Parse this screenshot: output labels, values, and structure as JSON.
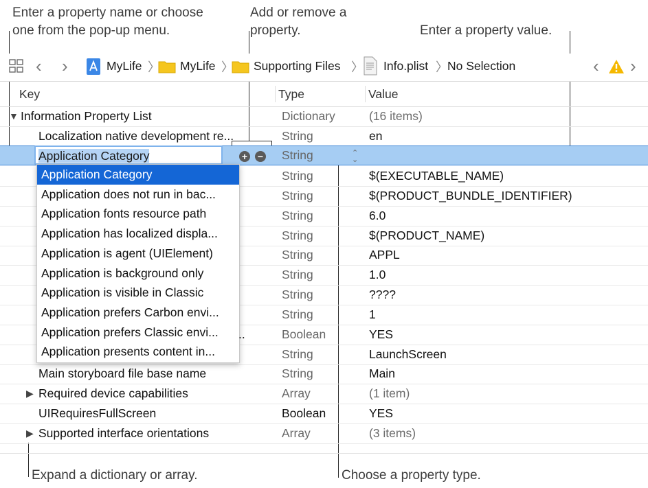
{
  "callouts": {
    "key_line1": "Enter a property name or choose",
    "key_line2": "one from the pop-up menu.",
    "addremove_line1": "Add or remove a",
    "addremove_line2": "property.",
    "value": "Enter a property value.",
    "expand": "Expand a dictionary or array.",
    "type": "Choose a property type."
  },
  "jumpbar": {
    "items": [
      "MyLife",
      "MyLife",
      "Supporting Files",
      "Info.plist",
      "No Selection"
    ],
    "icons": [
      "grid-icon",
      "back-arrow-icon",
      "forward-arrow-icon",
      "app-icon",
      "folder-icon",
      "folder-icon",
      "plist-file-icon",
      "warning-icon"
    ]
  },
  "table": {
    "headers": {
      "key": "Key",
      "type": "Type",
      "value": "Value"
    },
    "root": {
      "key": "Information Property List",
      "type": "Dictionary",
      "value": "(16 items)"
    },
    "rows": [
      {
        "key": "Localization native development re...",
        "type": "String",
        "value": "en"
      },
      {
        "key": "",
        "type": "String",
        "value": ""
      },
      {
        "key": "",
        "type": "String",
        "value": "$(EXECUTABLE_NAME)"
      },
      {
        "key": "",
        "type": "String",
        "value": "$(PRODUCT_BUNDLE_IDENTIFIER)"
      },
      {
        "key": "",
        "type": "String",
        "value": "6.0"
      },
      {
        "key": "",
        "type": "String",
        "value": "$(PRODUCT_NAME)"
      },
      {
        "key": "",
        "type": "String",
        "value": "APPL"
      },
      {
        "key": "",
        "type": "String",
        "value": "1.0"
      },
      {
        "key": "",
        "type": "String",
        "value": "????"
      },
      {
        "key": "",
        "type": "String",
        "value": "1"
      },
      {
        "key": "",
        "type": "Boolean",
        "value": "YES"
      },
      {
        "key": "",
        "type": "String",
        "value": "LaunchScreen"
      },
      {
        "key": "Main storyboard file base name",
        "type": "String",
        "value": "Main"
      },
      {
        "key": "Required device capabilities",
        "type": "Array",
        "value": "(1 item)"
      },
      {
        "key": "UIRequiresFullScreen",
        "type": "Boolean",
        "value": "YES"
      },
      {
        "key": "Supported interface orientations",
        "type": "Array",
        "value": "(3 items)"
      }
    ],
    "editing_key": "Application Category"
  },
  "popup": {
    "items": [
      "Application Category",
      "Application does not run in bac...",
      "Application fonts resource path",
      "Application has localized displa...",
      "Application is agent (UIElement)",
      "Application is background only",
      "Application is visible in Classic",
      "Application prefers Carbon envi...",
      "Application prefers Classic envi...",
      "Application presents content in..."
    ]
  },
  "colors": {
    "selection": "#a6cdf3",
    "highlight": "#1466d6",
    "warning": "#f5b800",
    "folder": "#f5c61f",
    "app": "#3b87e6"
  }
}
